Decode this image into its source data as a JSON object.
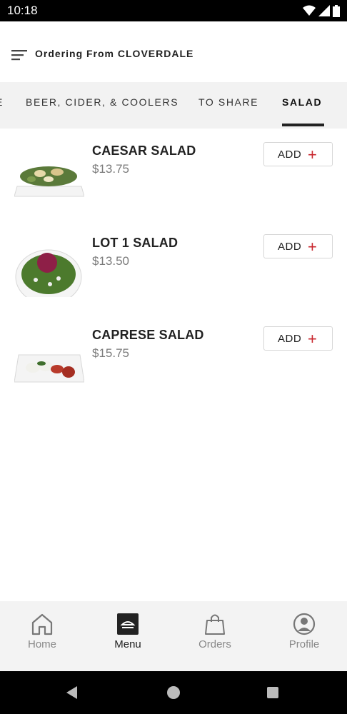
{
  "status": {
    "time": "10:18"
  },
  "header": {
    "title": "Ordering From CLOVERDALE",
    "menu_icon": "hamburger-menu-icon"
  },
  "tabs": [
    {
      "label": "E"
    },
    {
      "label": "BEER, CIDER, & COOLERS"
    },
    {
      "label": "TO SHARE"
    },
    {
      "label": "SALAD",
      "active": true
    }
  ],
  "items": [
    {
      "name": "CAESAR SALAD",
      "price": "$13.75",
      "add_label": "ADD",
      "add_icon": "+"
    },
    {
      "name": "LOT 1 SALAD",
      "price": "$13.50",
      "add_label": "ADD",
      "add_icon": "+"
    },
    {
      "name": "CAPRESE SALAD",
      "price": "$15.75",
      "add_label": "ADD",
      "add_icon": "+"
    }
  ],
  "bottom_nav": [
    {
      "label": "Home",
      "icon": "home-icon"
    },
    {
      "label": "Menu",
      "icon": "menu-icon",
      "active": true
    },
    {
      "label": "Orders",
      "icon": "shopping-bag-icon"
    },
    {
      "label": "Profile",
      "icon": "profile-icon"
    }
  ],
  "colors": {
    "accent": "#c8252c",
    "active_text": "#222222",
    "inactive_text": "#888888"
  }
}
